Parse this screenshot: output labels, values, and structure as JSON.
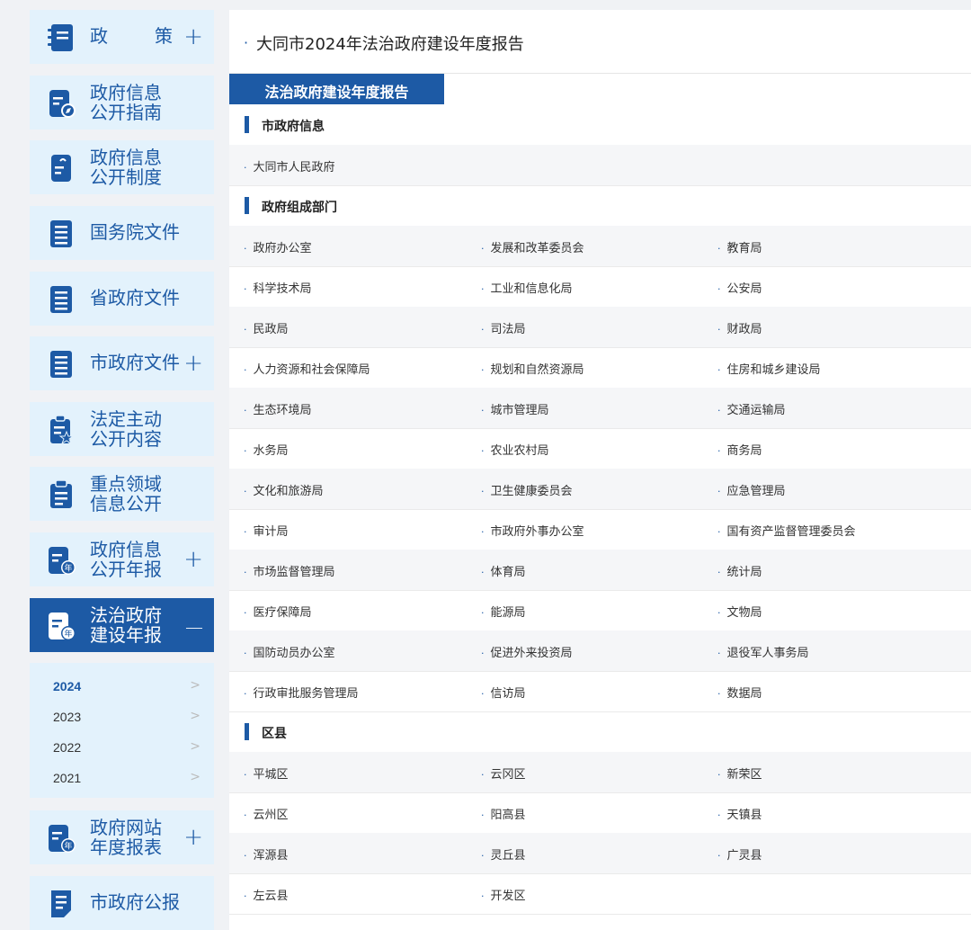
{
  "sidebar": {
    "items": [
      {
        "l1": "政",
        "l2": "策",
        "plus": "+",
        "icon": "notebook-icon"
      },
      {
        "l1": "政府信息",
        "l2": "公开指南",
        "icon": "compass-doc-icon"
      },
      {
        "l1": "政府信息",
        "l2": "公开制度",
        "icon": "doc-icon"
      },
      {
        "l1": "国务院文件",
        "icon": "list-doc-icon"
      },
      {
        "l1": "省政府文件",
        "icon": "list-doc-icon"
      },
      {
        "l1": "市政府文件",
        "plus": "+",
        "icon": "list-doc-icon"
      },
      {
        "l1": "法定主动",
        "l2": "公开内容",
        "icon": "star-doc-icon"
      },
      {
        "l1": "重点领域",
        "l2": "信息公开",
        "icon": "clipboard-icon"
      },
      {
        "l1": "政府信息",
        "l2": "公开年报",
        "plus": "+",
        "icon": "year-doc-icon"
      },
      {
        "l1": "法治政府",
        "l2": "建设年报",
        "plus": "—",
        "icon": "year-doc-icon"
      },
      {
        "l1": "政府网站",
        "l2": "年度报表",
        "plus": "+",
        "icon": "year-doc-icon"
      },
      {
        "l1": "市政府公报",
        "icon": "edit-doc-icon"
      }
    ],
    "years": [
      {
        "label": "2024",
        "chev": ">"
      },
      {
        "label": "2023",
        "chev": ">"
      },
      {
        "label": "2022",
        "chev": ">"
      },
      {
        "label": "2021",
        "chev": ">"
      }
    ]
  },
  "main": {
    "bullet": "·",
    "title": "大同市2024年法治政府建设年度报告",
    "tab": "法治政府建设年度报告",
    "sections": [
      {
        "title": "市政府信息",
        "rows": [
          [
            "大同市人民政府"
          ]
        ]
      },
      {
        "title": "政府组成部门",
        "rows": [
          [
            "政府办公室",
            "发展和改革委员会",
            "教育局"
          ],
          [
            "科学技术局",
            "工业和信息化局",
            "公安局"
          ],
          [
            "民政局",
            "司法局",
            "财政局"
          ],
          [
            "人力资源和社会保障局",
            "规划和自然资源局",
            "住房和城乡建设局"
          ],
          [
            "生态环境局",
            "城市管理局",
            "交通运输局"
          ],
          [
            "水务局",
            "农业农村局",
            "商务局"
          ],
          [
            "文化和旅游局",
            "卫生健康委员会",
            "应急管理局"
          ],
          [
            "审计局",
            "市政府外事办公室",
            "国有资产监督管理委员会"
          ],
          [
            "市场监督管理局",
            "体育局",
            "统计局"
          ],
          [
            "医疗保障局",
            "能源局",
            "文物局"
          ],
          [
            "国防动员办公室",
            "促进外来投资局",
            "退役军人事务局"
          ],
          [
            "行政审批服务管理局",
            "信访局",
            "数据局"
          ]
        ]
      },
      {
        "title": "区县",
        "rows": [
          [
            "平城区",
            "云冈区",
            "新荣区"
          ],
          [
            "云州区",
            "阳高县",
            "天镇县"
          ],
          [
            "浑源县",
            "灵丘县",
            "广灵县"
          ],
          [
            "左云县",
            "开发区"
          ]
        ]
      }
    ]
  },
  "colors": {
    "accent": "#1d5aa5",
    "light": "#e3f2fc"
  }
}
